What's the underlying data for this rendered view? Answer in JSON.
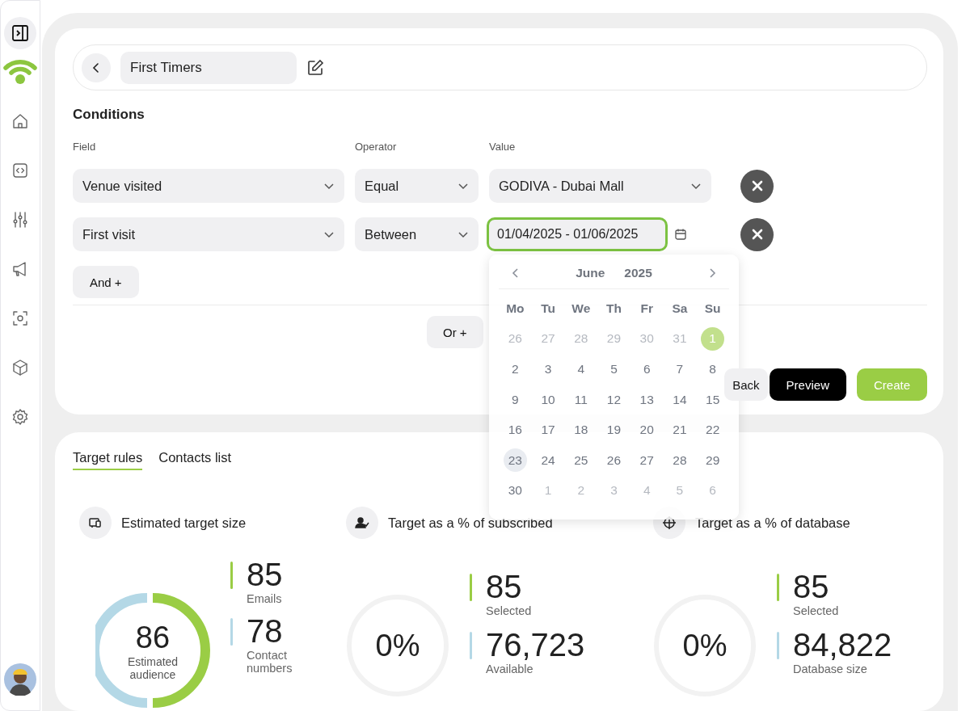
{
  "header": {
    "segment_name": "First Timers"
  },
  "conditions": {
    "title": "Conditions",
    "columns": [
      "Field",
      "Operator",
      "Value"
    ],
    "rows": [
      {
        "field": "Venue visited",
        "operator": "Equal",
        "value": "GODIVA - Dubai Mall",
        "kind": "select",
        "focused": false
      },
      {
        "field": "First visit",
        "operator": "Between",
        "value": "01/04/2025 - 01/06/2025",
        "kind": "date",
        "focused": true
      }
    ],
    "and_button": "And +",
    "or_button": "Or +"
  },
  "calendar": {
    "month": "June",
    "year": "2025",
    "weekdays": [
      "Mo",
      "Tu",
      "We",
      "Th",
      "Fr",
      "Sa",
      "Su"
    ],
    "weeks": [
      [
        {
          "day": "26",
          "muted": true,
          "selected": false,
          "today": false
        },
        {
          "day": "27",
          "muted": true,
          "selected": false,
          "today": false
        },
        {
          "day": "28",
          "muted": true,
          "selected": false,
          "today": false
        },
        {
          "day": "29",
          "muted": true,
          "selected": false,
          "today": false
        },
        {
          "day": "30",
          "muted": true,
          "selected": false,
          "today": false
        },
        {
          "day": "31",
          "muted": true,
          "selected": false,
          "today": false
        },
        {
          "day": "1",
          "muted": false,
          "selected": true,
          "today": false
        }
      ],
      [
        {
          "day": "2",
          "muted": false,
          "selected": false,
          "today": false
        },
        {
          "day": "3",
          "muted": false,
          "selected": false,
          "today": false
        },
        {
          "day": "4",
          "muted": false,
          "selected": false,
          "today": false
        },
        {
          "day": "5",
          "muted": false,
          "selected": false,
          "today": false
        },
        {
          "day": "6",
          "muted": false,
          "selected": false,
          "today": false
        },
        {
          "day": "7",
          "muted": false,
          "selected": false,
          "today": false
        },
        {
          "day": "8",
          "muted": false,
          "selected": false,
          "today": false
        }
      ],
      [
        {
          "day": "9",
          "muted": false,
          "selected": false,
          "today": false
        },
        {
          "day": "10",
          "muted": false,
          "selected": false,
          "today": false
        },
        {
          "day": "11",
          "muted": false,
          "selected": false,
          "today": false
        },
        {
          "day": "12",
          "muted": false,
          "selected": false,
          "today": false
        },
        {
          "day": "13",
          "muted": false,
          "selected": false,
          "today": false
        },
        {
          "day": "14",
          "muted": false,
          "selected": false,
          "today": false
        },
        {
          "day": "15",
          "muted": false,
          "selected": false,
          "today": false
        }
      ],
      [
        {
          "day": "16",
          "muted": false,
          "selected": false,
          "today": false
        },
        {
          "day": "17",
          "muted": false,
          "selected": false,
          "today": false
        },
        {
          "day": "18",
          "muted": false,
          "selected": false,
          "today": false
        },
        {
          "day": "19",
          "muted": false,
          "selected": false,
          "today": false
        },
        {
          "day": "20",
          "muted": false,
          "selected": false,
          "today": false
        },
        {
          "day": "21",
          "muted": false,
          "selected": false,
          "today": false
        },
        {
          "day": "22",
          "muted": false,
          "selected": false,
          "today": false
        }
      ],
      [
        {
          "day": "23",
          "muted": false,
          "selected": false,
          "today": true
        },
        {
          "day": "24",
          "muted": false,
          "selected": false,
          "today": false
        },
        {
          "day": "25",
          "muted": false,
          "selected": false,
          "today": false
        },
        {
          "day": "26",
          "muted": false,
          "selected": false,
          "today": false
        },
        {
          "day": "27",
          "muted": false,
          "selected": false,
          "today": false
        },
        {
          "day": "28",
          "muted": false,
          "selected": false,
          "today": false
        },
        {
          "day": "29",
          "muted": false,
          "selected": false,
          "today": false
        }
      ],
      [
        {
          "day": "30",
          "muted": false,
          "selected": false,
          "today": false
        },
        {
          "day": "1",
          "muted": true,
          "selected": false,
          "today": false
        },
        {
          "day": "2",
          "muted": true,
          "selected": false,
          "today": false
        },
        {
          "day": "3",
          "muted": true,
          "selected": false,
          "today": false
        },
        {
          "day": "4",
          "muted": true,
          "selected": false,
          "today": false
        },
        {
          "day": "5",
          "muted": true,
          "selected": false,
          "today": false
        },
        {
          "day": "6",
          "muted": true,
          "selected": false,
          "today": false
        }
      ]
    ]
  },
  "actions": [
    "Back",
    "Preview",
    "Create"
  ],
  "tabs": [
    {
      "label": "Target rules",
      "selected": true
    },
    {
      "label": "Contacts list",
      "selected": false
    }
  ],
  "stats": [
    {
      "title": "Estimated target size",
      "kind": "split",
      "center_value": "86",
      "center_label": "Estimated audience",
      "metrics": [
        {
          "value": "85",
          "label": "Emails",
          "color": "#9acd45"
        },
        {
          "value": "78",
          "label": "Contact numbers",
          "color": "#b4d8e6"
        }
      ]
    },
    {
      "title": "Target as a % of subscribed",
      "kind": "empty",
      "center_value": "0%",
      "metrics": [
        {
          "value": "85",
          "label": "Selected",
          "color": "#9acd45"
        },
        {
          "value": "76,723",
          "label": "Available",
          "color": "#b4d8e6"
        }
      ]
    },
    {
      "title": "Target as a % of database",
      "kind": "empty",
      "center_value": "0%",
      "metrics": [
        {
          "value": "85",
          "label": "Selected",
          "color": "#9acd45"
        },
        {
          "value": "84,822",
          "label": "Database size",
          "color": "#b4d8e6"
        }
      ]
    }
  ]
}
